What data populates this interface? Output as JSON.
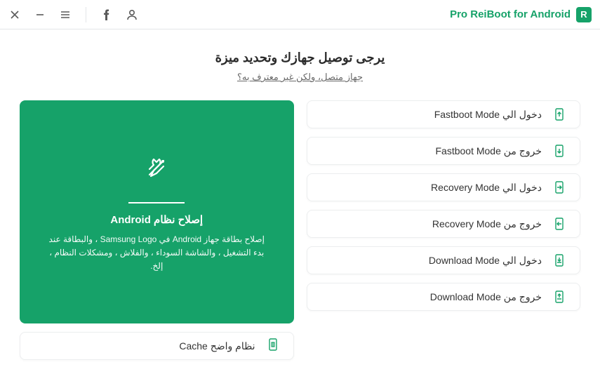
{
  "app": {
    "title": "Pro ReiBoot for Android",
    "logo_letter": "R"
  },
  "heading": "يرجى توصيل جهازك وتحديد ميزة",
  "sublink": "جهاز متصل، ولكن غير معترف به؟",
  "modes": [
    {
      "label": "دخول الي Fastboot Mode",
      "icon": "enter"
    },
    {
      "label": "خروج من Fastboot Mode",
      "icon": "exit"
    },
    {
      "label": "دخول الي Recovery Mode",
      "icon": "enter-side"
    },
    {
      "label": "خروج من Recovery Mode",
      "icon": "exit-side"
    },
    {
      "label": "دخول الي Download Mode",
      "icon": "download"
    },
    {
      "label": "خروج من Download Mode",
      "icon": "upload"
    }
  ],
  "repair": {
    "title": "إصلاح نظام Android",
    "desc": "إصلاح بطاقة جهاز Android في Samsung Logo ، والبطاقة عند بدء التشغيل ، والشاشة السوداء ، والفلاش ، ومشكلات النظام ، إلخ."
  },
  "cache": {
    "label": "نظام واضح Cache"
  },
  "colors": {
    "accent": "#16a269"
  }
}
